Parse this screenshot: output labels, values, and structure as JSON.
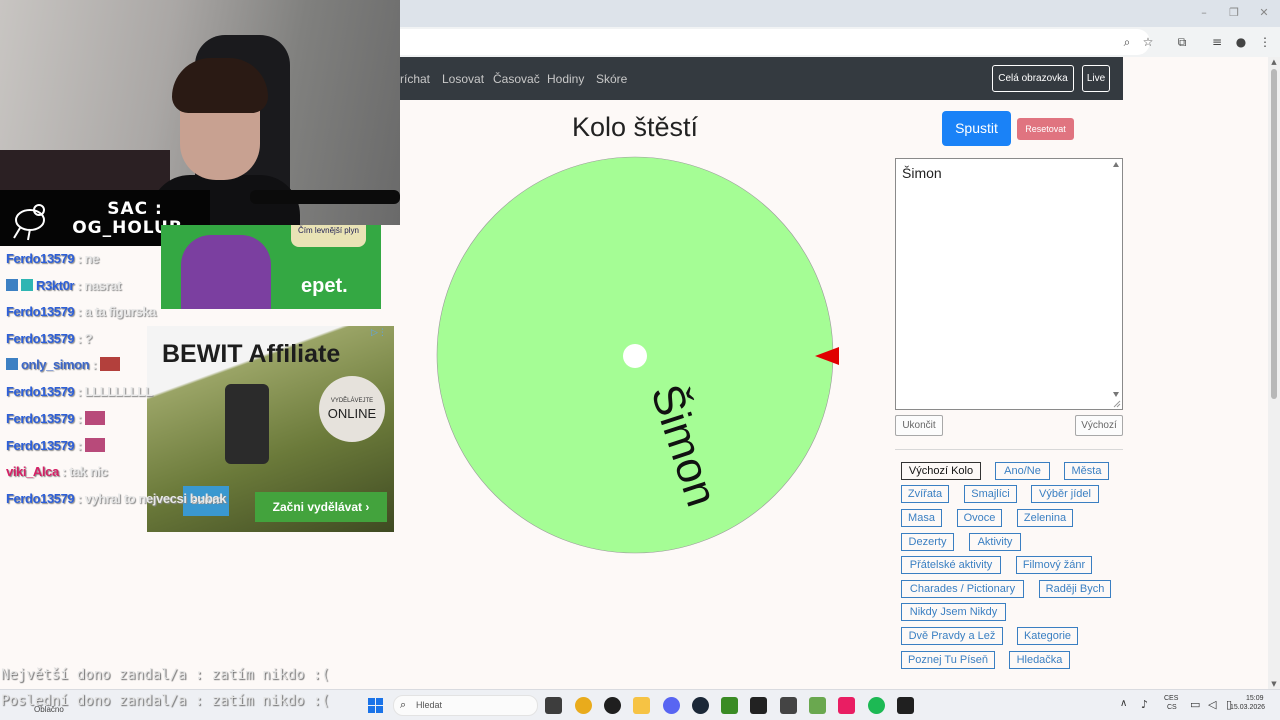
{
  "browser": {
    "window_controls": [
      "–",
      "❐",
      "✕"
    ],
    "toolbar_icons": [
      "zoom-icon",
      "star-icon",
      "extension-icon",
      "reading-list-icon",
      "profile-icon",
      "menu-icon"
    ]
  },
  "navbar": {
    "links": [
      "ríchat",
      "Losovat",
      "Časovač",
      "Hodiny",
      "Skóre"
    ],
    "fullscreen_label": "Celá obrazovka",
    "live_label": "Live"
  },
  "main": {
    "title": "Kolo štěstí",
    "start_label": "Spustit",
    "reset_label": "Resetovat",
    "entries_text": "Šimon",
    "end_label": "Ukončit",
    "default_label": "Výchozí",
    "wheel": {
      "segments": [
        "Šimon"
      ],
      "segment_color": "#a5fd95",
      "pointer_color": "#e00000"
    },
    "presets": [
      "Výchozí Kolo",
      "Ano/Ne",
      "Města",
      "Zvířata",
      "Smajlíci",
      "Výběr jídel",
      "Masa",
      "Ovoce",
      "Zelenina",
      "Dezerty",
      "Aktivity",
      "Přátelské aktivity",
      "Filmový žánr",
      "Charades / Pictionary",
      "Raději Bych",
      "Nikdy Jsem Nikdy",
      "Dvě Pravdy a Lež",
      "Kategorie",
      "Poznej Tu Píseň",
      "Hledačka"
    ]
  },
  "overlay": {
    "badge_line1": "SAC :",
    "badge_line2": "OG_HOLUB",
    "epet_pill": "Čím levnější plyn",
    "epet_logo": "epet.",
    "bewit_title": "BEWIT Affiliate",
    "bewit_circle_small": "VYDĚLÁVEJTE",
    "bewit_circle_big": "ONLINE",
    "bewit_logo": "BEWIT",
    "bewit_cta": "Začni vydělávat  ›",
    "chat": [
      {
        "user": "Ferdo13579",
        "msg": " : ne"
      },
      {
        "user": "R3kt0r",
        "msg": " : nasrat"
      },
      {
        "user": "Ferdo13579",
        "msg": " : a ta figurska"
      },
      {
        "user": "Ferdo13579",
        "msg": " : ?"
      },
      {
        "user": "only_simon",
        "msg": " : "
      },
      {
        "user": "Ferdo13579",
        "msg": " : LLLLLLLLL"
      },
      {
        "user": "Ferdo13579",
        "msg": " : "
      },
      {
        "user": "Ferdo13579",
        "msg": " : "
      },
      {
        "user": "viki_Alca",
        "msg": " : tak nic"
      },
      {
        "user": "Ferdo13579",
        "msg": " : vyhral to nejvecsi bubak"
      }
    ],
    "donor_biggest": "Největší dono zandal/a : zatím  nikdo :(",
    "donor_last": "Poslední dono zandal/a : zatím nikdo :("
  },
  "taskbar": {
    "weather": "Oblačno",
    "search_placeholder": "Hledat",
    "lang_line1": "CES",
    "lang_line2": "CS",
    "time": "15:09",
    "date": "15.03.2026",
    "app_colors": [
      "#3d3d3d",
      "#e9ab1c",
      "#1f1f1f",
      "#f6c344",
      "#5865f2",
      "#1b2838",
      "#3a8b24",
      "#222222",
      "#444444",
      "#6aa84f",
      "#e91e63",
      "#1db954",
      "#202020"
    ]
  }
}
